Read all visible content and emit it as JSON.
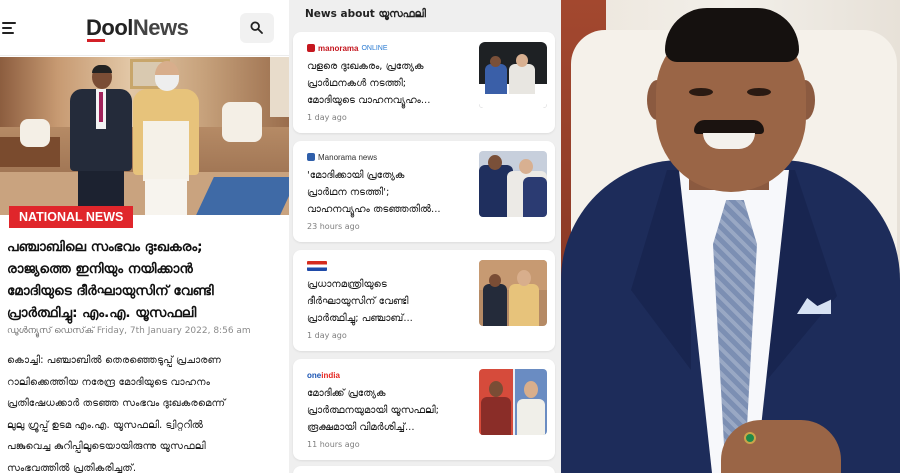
{
  "left": {
    "brand": {
      "part1": "Dool",
      "part2": "News"
    },
    "category_tag": "NATIONAL NEWS",
    "headline": "പഞ്ചാബിലെ സംഭവം ദുഃഖകരം;\nരാജ്യത്തെ ഇനിയും നയിക്കാൻ\nമോദിയുടെ ദീർഘായുസിന് വേണ്ടി\nപ്രാർത്ഥിച്ചു: എം.എ. യൂസഫലി",
    "author": "ഡൂള്‍ന്യൂസ് ഡെസ്‌ക്",
    "date": "Friday, 7th January 2022, 8:56 am",
    "body": "കൊച്ചി: പഞ്ചാബിൽ തെരഞ്ഞെടുപ്പ് പ്രചാരണ\nറാലിക്കെത്തിയ നരേന്ദ്ര മോദിയുടെ വാഹനം\nപ്രതിഷേധക്കാർ തടഞ്ഞ സംഭവം ദുഃഖകരമെന്ന്\nലുലു ഗ്രൂപ്പ് ഉടമ എം.എ. യൂസഫലി. ട്വിറ്ററിൽ\nപങ്കുവെച്ച കുറിപ്പിലൂടെയായിരുന്നു യൂസഫലി\nസംഭവത്തിൽ പ്രതികരിച്ചത്."
  },
  "middle": {
    "section_title": "News about യൂസഫലി",
    "cards": [
      {
        "source": "manorama",
        "source_suffix": "ONLINE",
        "title": "വളരെ ദുഃഖകരം, പ്രത്യേക\nപ്രാർഥനകൾ നടത്തി;\nമോദിയുടെ വാഹനവ്യൂഹം...",
        "time": "1 day ago"
      },
      {
        "source": "Manorama news",
        "title": "'മോദിക്കായി പ്രത്യേക\nപ്രാർഥന നടത്തി';\nവാഹനവ്യൂഹം തടഞ്ഞതിൽ...",
        "time": "23 hours ago"
      },
      {
        "source": "",
        "title": "പ്രധാനമന്ത്രിയുടെ\nദീർഘായുസിന് വേണ്ടി\nപ്രാർത്ഥിച്ചു; പഞ്ചാബ്...",
        "time": "1 day ago"
      },
      {
        "source": "one",
        "source_suffix": "india",
        "title": "മോദിക്ക് പ്രത്യേക\nപ്രാർത്ഥനയുമായി യൂസഫലി;\nരൂക്ഷമായി വിമർശിച്ച്...",
        "time": "11 hours ago"
      }
    ]
  },
  "colors": {
    "tag_red": "#e0262b",
    "suit_navy": "#1d2c5a",
    "card_bg": "#ffffff",
    "panel_bg": "#efefef"
  }
}
